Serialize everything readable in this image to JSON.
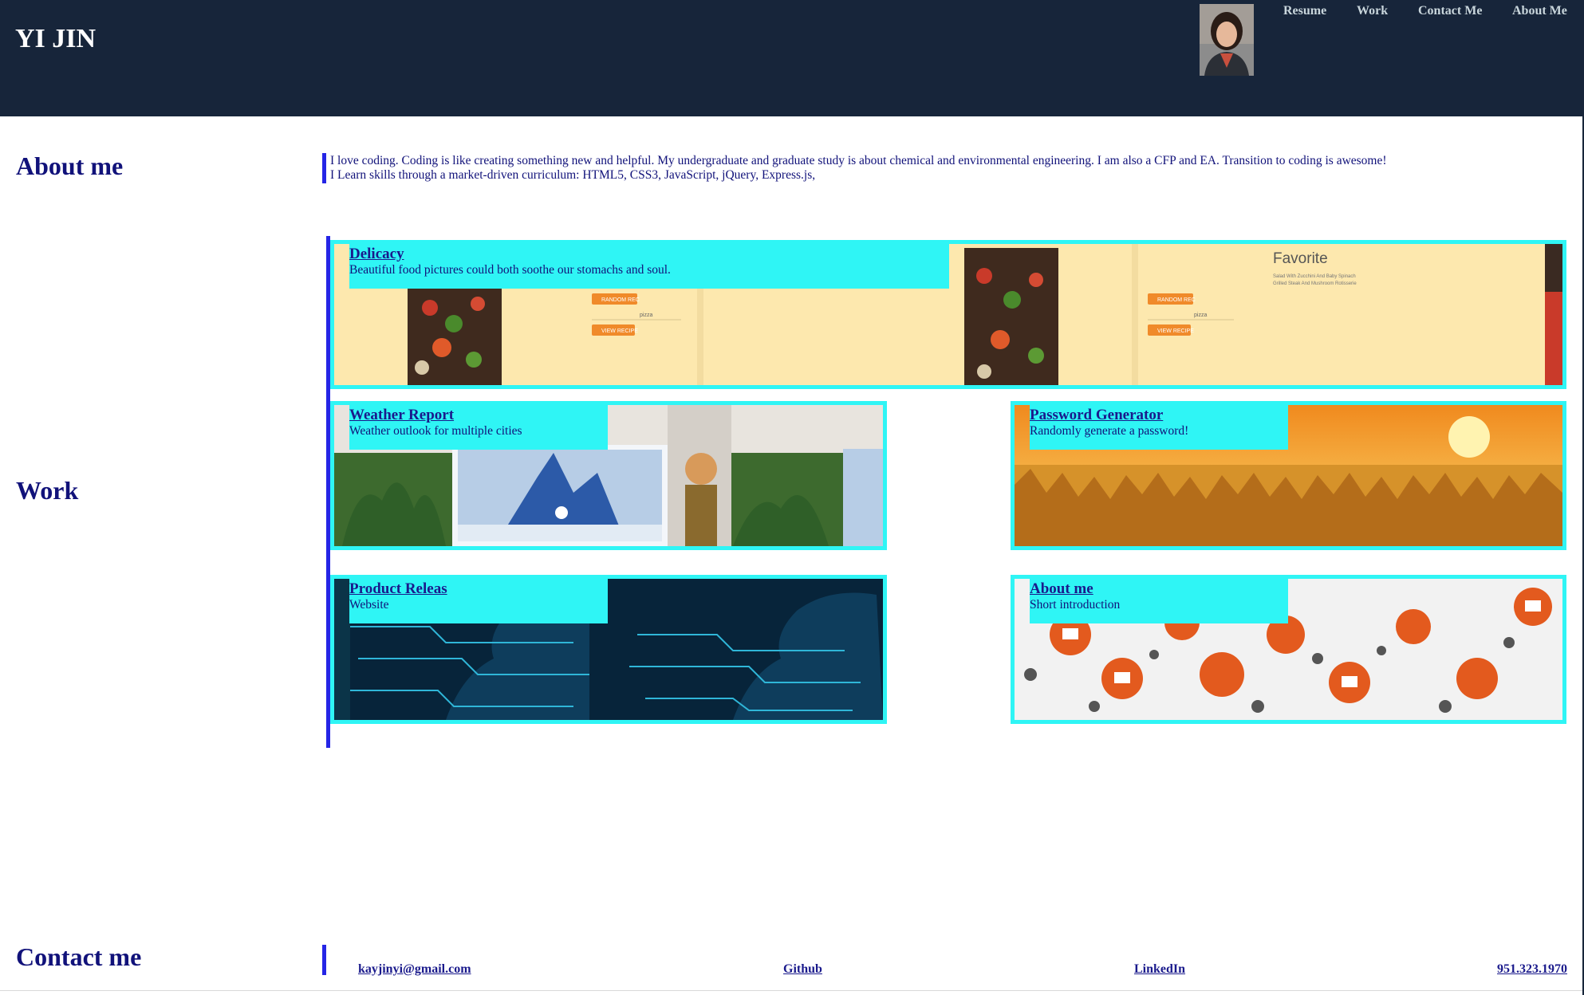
{
  "header": {
    "brand": "YI JIN",
    "nav": [
      "Resume",
      "Work",
      "Contact Me",
      "About Me"
    ]
  },
  "about": {
    "heading": "About me",
    "line1": "I love coding. Coding is like creating something new and helpful. My undergraduate and graduate study is about chemical and environmental engineering. I am also a CFP and EA. Transition to coding is awesome!",
    "line2": "I Learn skills through a market-driven curriculum: HTML5, CSS3, JavaScript, jQuery, Express.js,"
  },
  "work": {
    "heading": "Work",
    "projects": [
      {
        "title": "Delicacy",
        "desc": "Beautiful food pictures could both soothe our stomachs and soul."
      },
      {
        "title": "Weather Report",
        "desc": "Weather outlook for multiple cities"
      },
      {
        "title": "Password Generator",
        "desc": "Randomly generate a password!"
      },
      {
        "title": "Product Releas",
        "desc": "Website"
      },
      {
        "title": "About me",
        "desc": "Short introduction"
      }
    ],
    "delicacy_screens": {
      "button1": "RANDOM REC",
      "search": "pizza",
      "button2": "VIEW RECIPE",
      "fav_title": "Favorite",
      "fav_item1": "Salad With Zucchini And Baby Spinach",
      "fav_item2": "Grilled Steak And Mushroom Rotisserie"
    }
  },
  "contact": {
    "heading": "Contact me",
    "email": "kayjinyi@gmail.com",
    "github": "Github",
    "linkedin": "LinkedIn",
    "phone": "951.323.1970"
  },
  "colors": {
    "header_bg": "#17253a",
    "accent": "#2ff5f5",
    "bar": "#2525e6",
    "text": "#11127a"
  }
}
